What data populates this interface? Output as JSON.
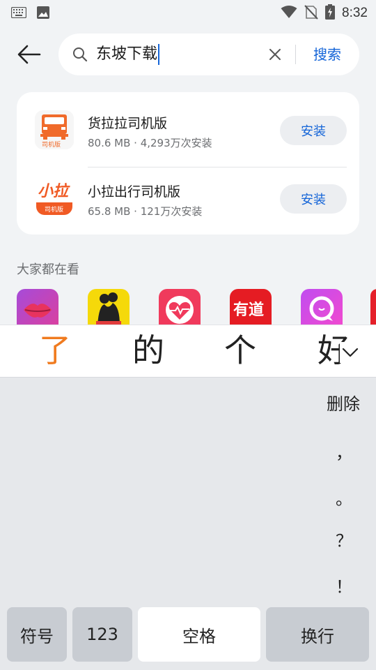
{
  "status_bar": {
    "time": "8:32"
  },
  "search": {
    "query": "东坡下载",
    "submit_label": "搜索"
  },
  "results": [
    {
      "name": "货拉拉司机版",
      "meta": "80.6 MB · 4,293万次安装",
      "install_label": "安装",
      "icon_text": "司机版"
    },
    {
      "name": "小拉出行司机版",
      "meta": "65.8 MB · 121万次安装",
      "install_label": "安装",
      "icon_title": "小拉",
      "icon_text": "司机版"
    }
  ],
  "section": {
    "title": "大家都在看"
  },
  "recommended": [
    {
      "icon": "lips-app-icon"
    },
    {
      "icon": "couple-app-icon"
    },
    {
      "icon": "heart-pulse-app-icon"
    },
    {
      "icon": "youdao-app-icon",
      "icon_text": "有道"
    },
    {
      "icon": "chat-bubble-app-icon"
    }
  ],
  "candidates": [
    "了",
    "的",
    "个",
    "好"
  ],
  "keyboard": {
    "side_keys": [
      "删除",
      "，",
      "。",
      "？",
      "！"
    ],
    "bottom_keys": {
      "symbols": "符号",
      "numbers": "123",
      "space": "空格",
      "enter": "换行"
    }
  },
  "colors": {
    "accent": "#1565d8",
    "candidate_highlight": "#f07b1f",
    "background": "#f1f3f5"
  }
}
